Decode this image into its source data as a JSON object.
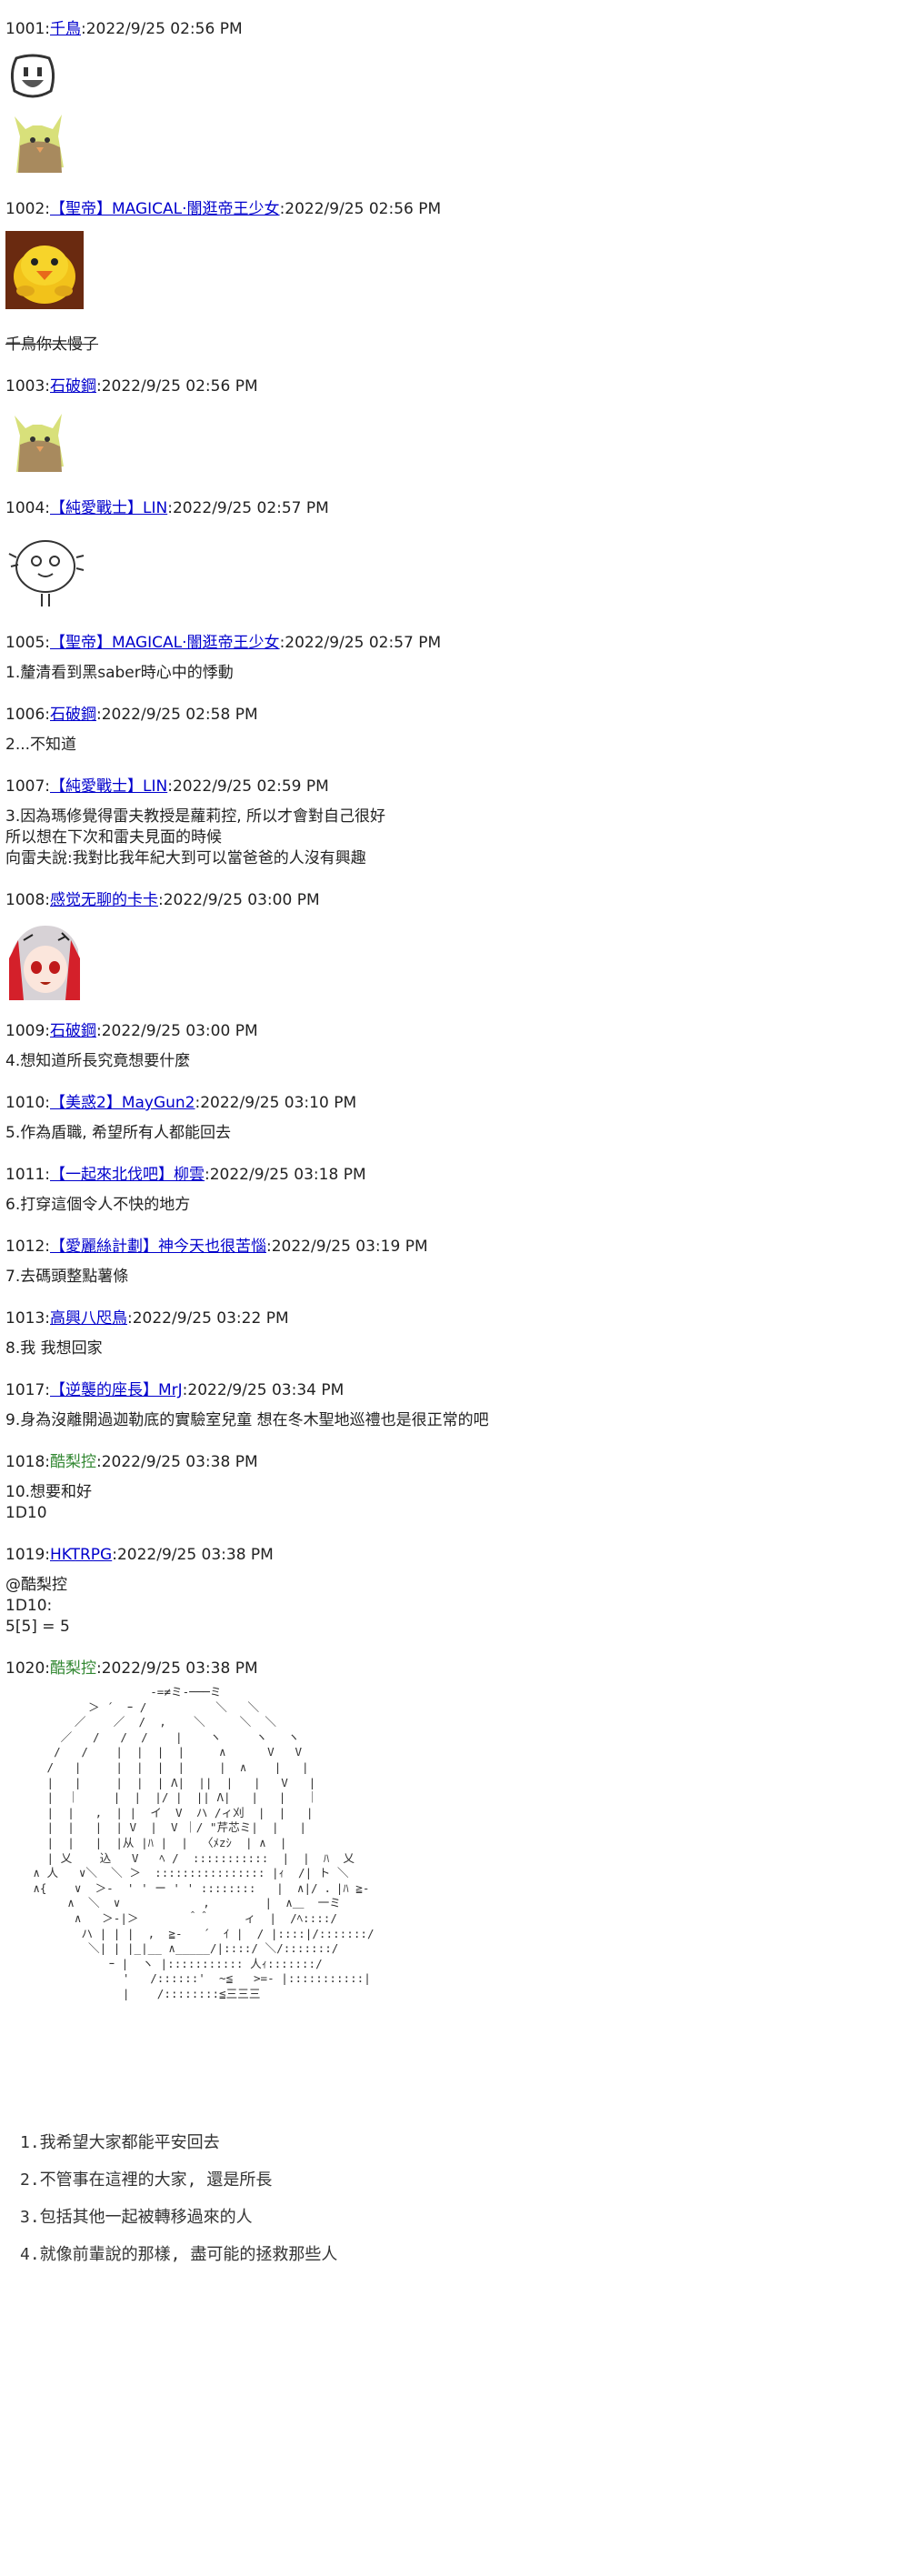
{
  "posts": [
    {
      "num": "1001",
      "name": "千鳥",
      "date": "2022/9/25 02:56 PM"
    },
    {
      "num": "1002",
      "name": "【聖帝】MAGICAL·闇逛帝王少女",
      "date": "2022/9/25 02:56 PM",
      "body": "千鳥你太慢了"
    },
    {
      "num": "1003",
      "name": "石破鋼",
      "date": "2022/9/25 02:56 PM"
    },
    {
      "num": "1004",
      "name": "【純愛戰士】LIN",
      "date": "2022/9/25 02:57 PM"
    },
    {
      "num": "1005",
      "name": "【聖帝】MAGICAL·闇逛帝王少女",
      "date": "2022/9/25 02:57 PM",
      "body": "1.釐清看到黑saber時心中的悸動"
    },
    {
      "num": "1006",
      "name": "石破鋼",
      "date": "2022/9/25 02:58 PM",
      "body": "2...不知道"
    },
    {
      "num": "1007",
      "name": "【純愛戰士】LIN",
      "date": "2022/9/25 02:59 PM",
      "body": "3.因為瑪修覺得雷夫教授是蘿莉控, 所以才會對自己很好\n所以想在下次和雷夫見面的時候\n向雷夫說:我對比我年紀大到可以當爸爸的人沒有興趣"
    },
    {
      "num": "1008",
      "name": "感觉无聊的卡卡",
      "date": "2022/9/25 03:00 PM"
    },
    {
      "num": "1009",
      "name": "石破鋼",
      "date": "2022/9/25 03:00 PM",
      "body": "4.想知道所長究竟想要什麼"
    },
    {
      "num": "1010",
      "name": "【美惑2】MayGun2",
      "date": "2022/9/25 03:10 PM",
      "body": "5.作為盾職, 希望所有人都能回去"
    },
    {
      "num": "1011",
      "name": "【一起來北伐吧】柳雲",
      "date": "2022/9/25 03:18 PM",
      "body": "6.打穿這個令人不快的地方"
    },
    {
      "num": "1012",
      "name": "【愛麗絲計劃】神今天也很苦惱",
      "date": "2022/9/25 03:19 PM",
      "body": "7.去碼頭整點薯條"
    },
    {
      "num": "1013",
      "name": "高興八咫鳥",
      "date": "2022/9/25 03:22 PM",
      "body": "8.我 我想回家"
    },
    {
      "num": "1017",
      "name": "【逆襲的座長】MrJ",
      "date": "2022/9/25 03:34 PM",
      "body": "9.身為沒離開過迦勒底的實驗室兒童 想在冬木聖地巡禮也是很正常的吧"
    },
    {
      "num": "1018",
      "name": "酷梨控",
      "date": "2022/9/25 03:38 PM",
      "body": "10.想要和好\n1D10"
    },
    {
      "num": "1019",
      "name": "HKTRPG",
      "date": "2022/9/25 03:38 PM",
      "body": "@酷梨控\n1D10:\n5[5] = 5"
    },
    {
      "num": "1020",
      "name": "酷梨控",
      "date": "2022/9/25 03:38 PM"
    }
  ],
  "aa_lines": [
    "1.我希望大家都能平安回去",
    "2.不管事在這裡的大家, 還是所長",
    "3.包括其他一起被轉移過來的人",
    "4.就像前輩說的那樣, 盡可能的拯救那些人"
  ],
  "colors": {
    "link": "#0000cc",
    "green_name": "#338833",
    "text": "#222222"
  },
  "images": [
    "smiley-face-emoji",
    "cat-bird-sticker",
    "yellow-chick-sticker",
    "cat-bird-sticker",
    "doodle-face-sticker",
    "anime-girl-sticker"
  ]
}
